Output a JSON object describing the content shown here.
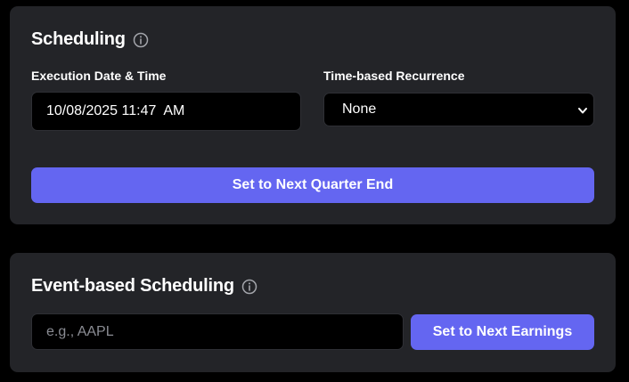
{
  "scheduling": {
    "title": "Scheduling",
    "execution_label": "Execution Date & Time",
    "execution_value": "10/08/2025 11:47  AM",
    "recurrence_label": "Time-based Recurrence",
    "recurrence_value": "None",
    "quarter_button": "Set to Next Quarter End"
  },
  "event_scheduling": {
    "title": "Event-based Scheduling",
    "ticker_placeholder": "e.g., AAPL",
    "earnings_button": "Set to Next Earnings"
  },
  "colors": {
    "card_bg": "#232428",
    "accent": "#6466f1",
    "page_bg": "#000000"
  },
  "icons": {
    "info": "info-icon",
    "select_arrow": "chevron-down-icon"
  }
}
